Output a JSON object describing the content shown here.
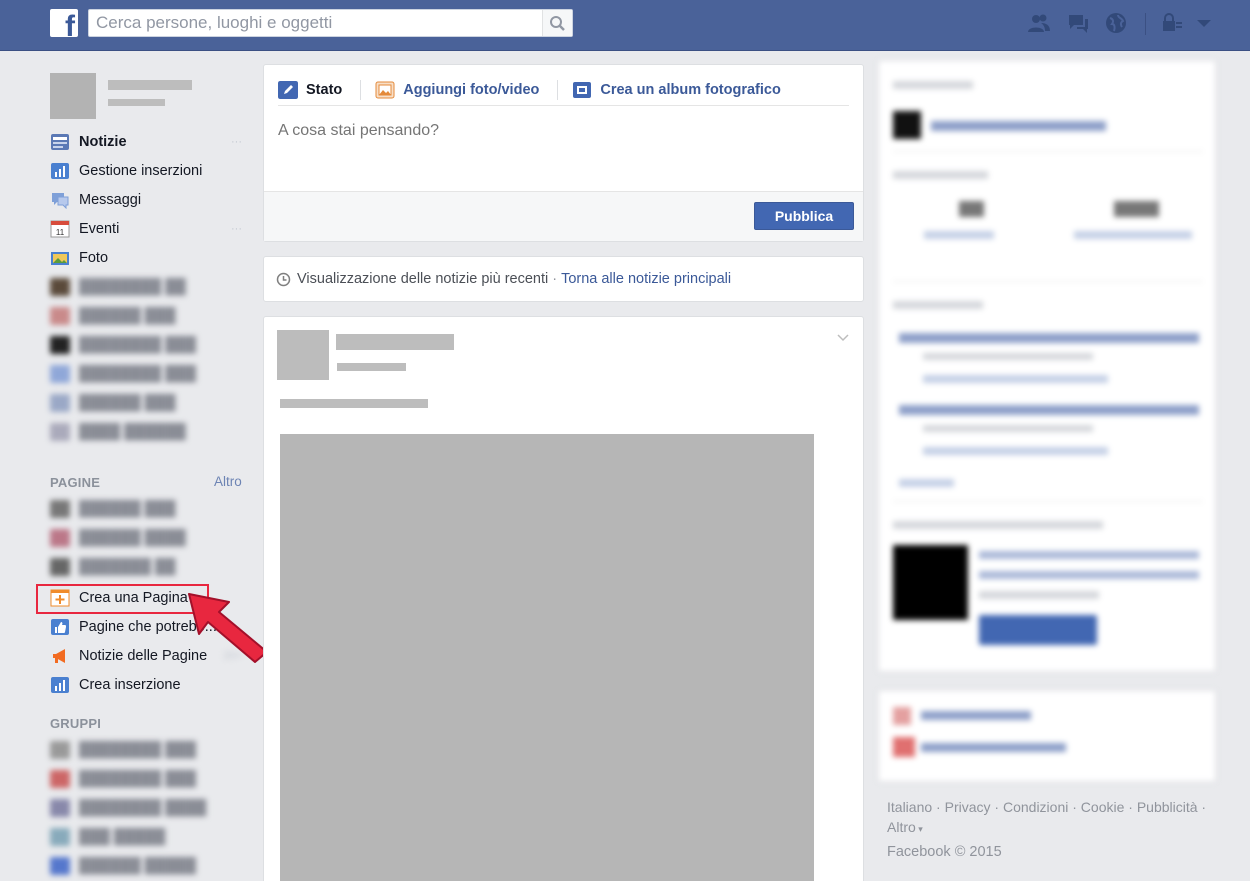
{
  "search": {
    "placeholder": "Cerca persone, luoghi e oggetti"
  },
  "logo": {
    "letter": "f"
  },
  "topbar_icons": [
    "friends-icon",
    "messages-icon",
    "globe-icon",
    "privacy-lock-icon",
    "chevron-down-icon"
  ],
  "left_nav": {
    "items": [
      {
        "label": "Notizie",
        "icon": "news-feed-icon",
        "count": "",
        "bold": true
      },
      {
        "label": "Gestione inserzioni",
        "icon": "ads-manager-icon",
        "count": ""
      },
      {
        "label": "Messaggi",
        "icon": "messages-icon",
        "count": ""
      },
      {
        "label": "Eventi",
        "icon": "calendar-icon",
        "count": ""
      },
      {
        "label": "Foto",
        "icon": "photos-icon",
        "count": ""
      }
    ],
    "pages_title": "PAGINE",
    "pages_more": "Altro",
    "pages_items": [
      {
        "label": "Crea una Pagina",
        "icon": "create-page-icon"
      },
      {
        "label": "Pagine che potrebb...",
        "icon": "like-icon"
      },
      {
        "label": "Notizie delle Pagine",
        "icon": "megaphone-icon"
      },
      {
        "label": "Crea inserzione",
        "icon": "ads-manager-icon"
      }
    ],
    "groups_title": "GRUPPI"
  },
  "composer": {
    "tabs": [
      {
        "label": "Stato",
        "icon": "pencil-icon"
      },
      {
        "label": "Aggiungi foto/video",
        "icon": "photo-icon"
      },
      {
        "label": "Crea un album fotografico",
        "icon": "album-icon"
      }
    ],
    "placeholder": "A cosa stai pensando?",
    "publish": "Pubblica"
  },
  "feed_sort": {
    "text": "Visualizzazione delle notizie più recenti",
    "separator": "·",
    "link": "Torna alle notizie principali"
  },
  "footer": {
    "links": [
      "Italiano",
      "Privacy",
      "Condizioni",
      "Cookie",
      "Pubblicità"
    ],
    "more": "Altro",
    "copyright": "Facebook © 2015"
  },
  "colors": {
    "brand": "#4a6299",
    "highlight": "#e8273f",
    "link": "#3b5998"
  }
}
